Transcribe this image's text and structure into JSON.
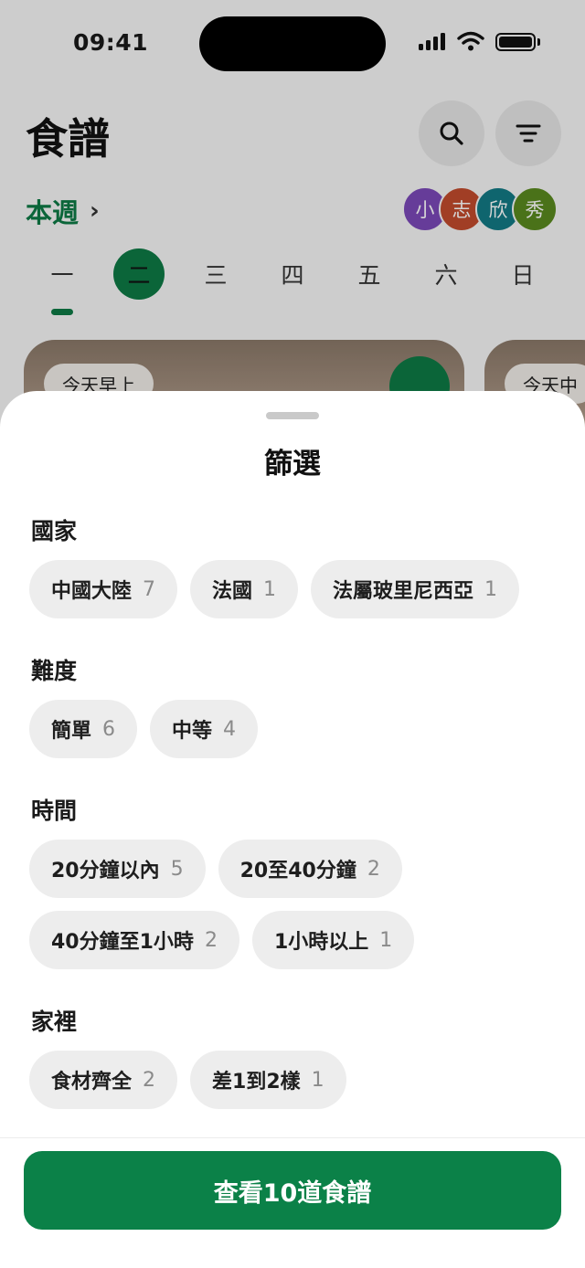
{
  "status_bar": {
    "time": "09:41"
  },
  "header": {
    "title": "食譜",
    "week_label": "本週",
    "week_chevron": "›",
    "avatars": [
      {
        "label": "小",
        "color": "#7b49b8"
      },
      {
        "label": "志",
        "color": "#c24b2d"
      },
      {
        "label": "欣",
        "color": "#137a85"
      },
      {
        "label": "秀",
        "color": "#5a8a1f"
      }
    ]
  },
  "days": {
    "items": [
      "一",
      "二",
      "三",
      "四",
      "五",
      "六",
      "日"
    ],
    "selected_index": 1
  },
  "cards": [
    {
      "tag": "今天早上"
    },
    {
      "tag": "今天中"
    }
  ],
  "sheet": {
    "title": "篩選",
    "sections": [
      {
        "title": "國家",
        "chips": [
          {
            "label": "中國大陸",
            "count": "7"
          },
          {
            "label": "法國",
            "count": "1"
          },
          {
            "label": "法屬玻里尼西亞",
            "count": "1"
          }
        ]
      },
      {
        "title": "難度",
        "chips": [
          {
            "label": "簡單",
            "count": "6"
          },
          {
            "label": "中等",
            "count": "4"
          }
        ]
      },
      {
        "title": "時間",
        "chips": [
          {
            "label": "20分鐘以內",
            "count": "5"
          },
          {
            "label": "20至40分鐘",
            "count": "2"
          },
          {
            "label": "40分鐘至1小時",
            "count": "2"
          },
          {
            "label": "1小時以上",
            "count": "1"
          }
        ]
      },
      {
        "title": "家裡",
        "chips": [
          {
            "label": "食材齊全",
            "count": "2"
          },
          {
            "label": "差1到2樣",
            "count": "1"
          }
        ]
      }
    ],
    "cta_label": "查看10道食譜"
  },
  "colors": {
    "accent": "#0e7a45",
    "cta": "#0b8148",
    "chip_bg": "#ededed"
  }
}
